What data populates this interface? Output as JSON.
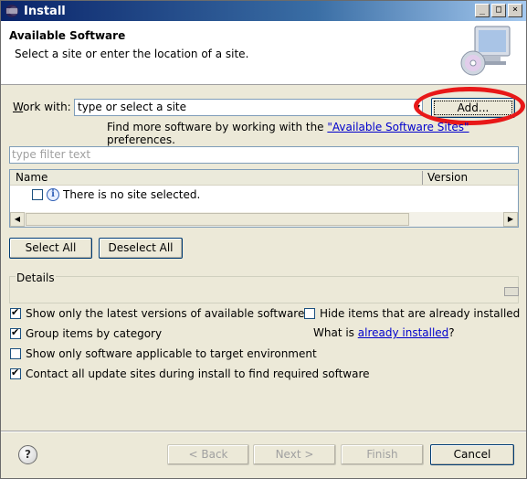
{
  "window": {
    "title": "Install",
    "controls": [
      "_",
      "□",
      "×"
    ]
  },
  "banner": {
    "title": "Available Software",
    "description": "Select a site or enter the location of a site."
  },
  "work_with": {
    "label": "Work with:",
    "placeholder": "type or select a site",
    "add_button": "Add...",
    "find_more_prefix": "Find more software by working with the ",
    "find_more_link": "\"Available Software Sites\"",
    "find_more_suffix": " preferences."
  },
  "filter": {
    "placeholder": "type filter text"
  },
  "table": {
    "columns": [
      "Name",
      "Version"
    ],
    "rows": [
      {
        "checked": false,
        "icon": "info-icon",
        "text": "There is no site selected."
      }
    ]
  },
  "selection_buttons": {
    "select_all": "Select All",
    "deselect_all": "Deselect All"
  },
  "details": {
    "label": "Details"
  },
  "options": {
    "show_latest": {
      "label": "Show only the latest versions of available software",
      "checked": true
    },
    "hide_installed": {
      "label": "Hide items that are already installed",
      "checked": false
    },
    "group_by_category": {
      "label": "Group items by category",
      "checked": true
    },
    "what_is_prefix": "What is ",
    "what_is_link": "already installed",
    "what_is_suffix": "?",
    "target_env": {
      "label": "Show only software applicable to target environment",
      "checked": false
    },
    "contact_sites": {
      "label": "Contact all update sites during install to find required software",
      "checked": true
    }
  },
  "footer": {
    "back": "< Back",
    "next": "Next >",
    "finish": "Finish",
    "cancel": "Cancel",
    "help": "?"
  },
  "colors": {
    "title_bar": "#0a246a",
    "link": "#0000cc",
    "highlight_circle": "#e81818",
    "dialog_bg": "#ece9d8"
  }
}
